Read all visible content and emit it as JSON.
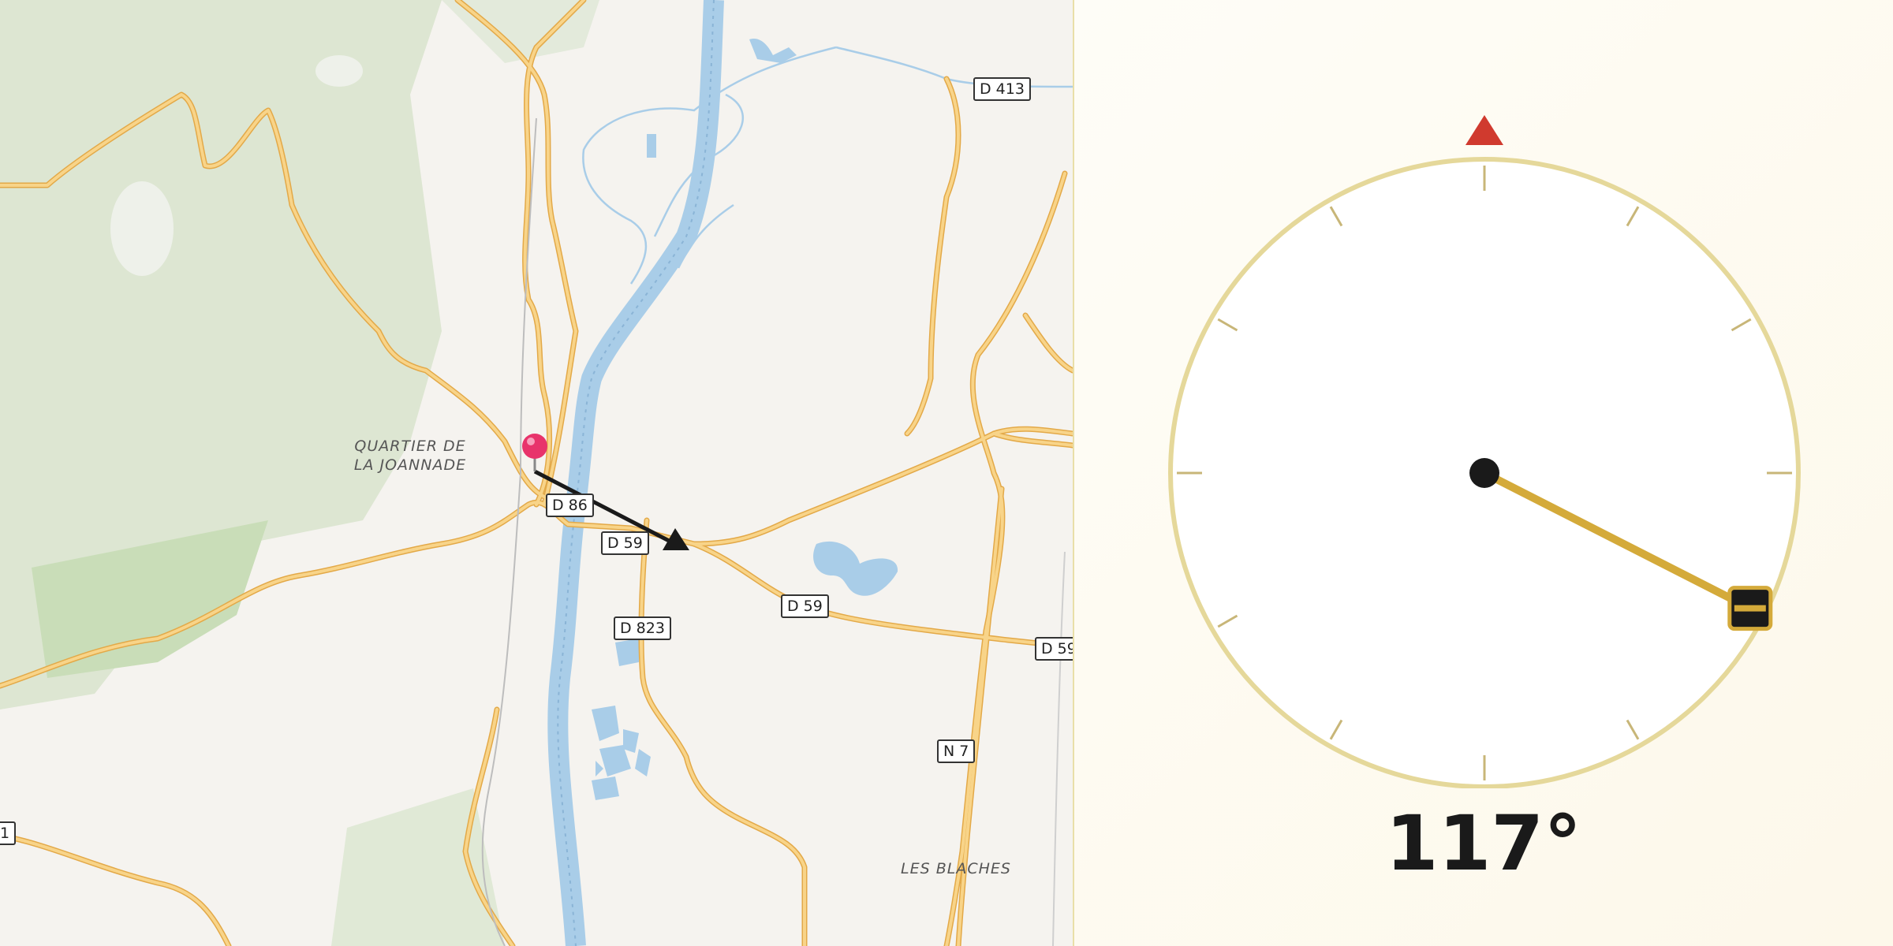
{
  "map": {
    "road_labels": {
      "d413": "D 413",
      "d86": "D 86",
      "d59_a": "D 59",
      "d59_b": "D 59",
      "d59_c": "D 59",
      "d823": "D 823",
      "n7": "N 7",
      "edge_1": "1"
    },
    "place_labels": {
      "quartier_line1": "QUARTIER DE",
      "quartier_line2": "LA JOANNADE",
      "les_blaches": "LES BLACHES"
    },
    "colors": {
      "road": "#f5c66a",
      "road_casing": "#e3a948",
      "water": "#a9cde8",
      "forest": "#dbe6d0",
      "marker": "#e8336b"
    },
    "marker_icon": "map-pin-icon",
    "direction_arrow_icon": "arrow-icon"
  },
  "compass": {
    "heading_deg": 117,
    "heading_text": "117°",
    "north_marker_icon": "north-triangle-icon",
    "colors": {
      "ring": "#e5d89a",
      "needle": "#d4aa3a",
      "north": "#d03a2e",
      "hub": "#1a1a1a"
    }
  }
}
